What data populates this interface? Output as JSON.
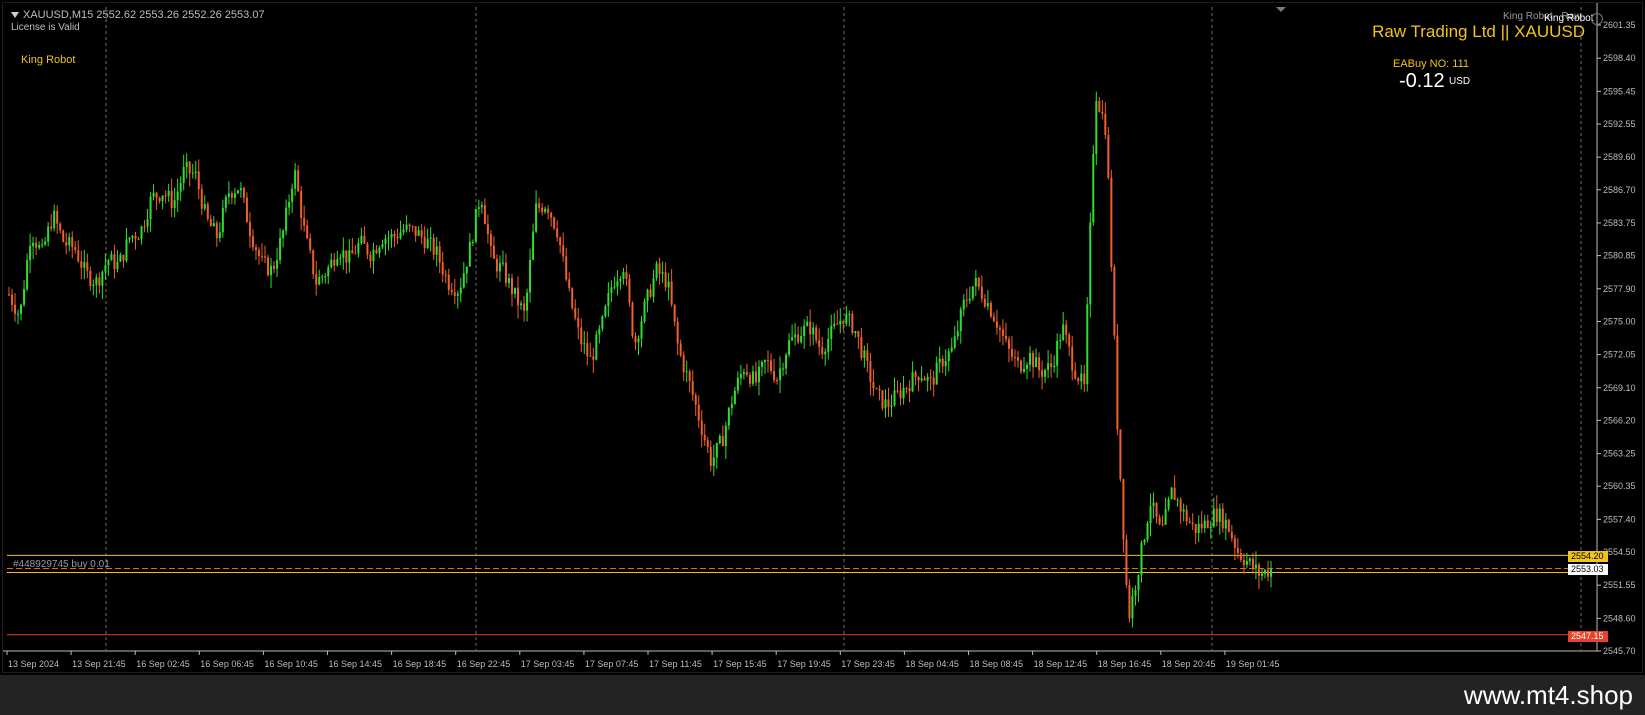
{
  "header": {
    "symbol_info": "XAUUSD,M15  2552.62 2553.26 2552.26 2553.07",
    "license": "License is Valid",
    "ea_name": "King Robot",
    "ea_name_top": "King Robot - Raw",
    "ea_name_top2": "King Robot"
  },
  "panel": {
    "broker_title": "Raw Trading Ltd || XAUUSD",
    "ea_buy": "EABuy NO: 111",
    "pnl": "-0.12",
    "pnl_unit": "USD"
  },
  "order": {
    "label": "#448929745 buy 0.01"
  },
  "price_tags": {
    "yellow": "2554.20",
    "white": "2553.03",
    "red": "2547.15"
  },
  "footer": {
    "watermark": "www.mt4.shop"
  },
  "colors": {
    "bull": "#2ee02e",
    "bear": "#f0602a",
    "gold_line": "#f0c419",
    "red_line": "#e8432a",
    "grid": "#707070"
  },
  "chart_data": {
    "type": "candlestick",
    "symbol": "XAUUSD",
    "timeframe": "M15",
    "y_ticks": [
      "2601.35",
      "2598.40",
      "2595.45",
      "2592.55",
      "2589.60",
      "2586.70",
      "2583.75",
      "2580.85",
      "2577.90",
      "2575.00",
      "2572.05",
      "2569.10",
      "2566.20",
      "2563.25",
      "2560.35",
      "2557.40",
      "2554.50",
      "2551.55",
      "2548.60",
      "2545.70"
    ],
    "ylim": [
      2545.7,
      2601.35
    ],
    "x_ticks": [
      "13 Sep 2024",
      "13 Sep 21:45",
      "16 Sep 02:45",
      "16 Sep 06:45",
      "16 Sep 10:45",
      "16 Sep 14:45",
      "16 Sep 18:45",
      "16 Sep 22:45",
      "17 Sep 03:45",
      "17 Sep 07:45",
      "17 Sep 11:45",
      "17 Sep 15:45",
      "17 Sep 19:45",
      "17 Sep 23:45",
      "18 Sep 04:45",
      "18 Sep 08:45",
      "18 Sep 12:45",
      "18 Sep 16:45",
      "18 Sep 20:45",
      "19 Sep 01:45"
    ],
    "lines": {
      "order_entry": 2554.2,
      "bid": 2553.03,
      "stop_loss": 2547.15
    },
    "path": [
      2577.4,
      2575.5,
      2583.0,
      2581.0,
      2584.5,
      2582.0,
      2581.5,
      2579.2,
      2578.5,
      2580.5,
      2580.0,
      2582.5,
      2583.0,
      2586.0,
      2586.5,
      2585.5,
      2588.5,
      2588.0,
      2584.0,
      2582.5,
      2586.5,
      2587.0,
      2583.0,
      2580.2,
      2579.5,
      2583.0,
      2588.5,
      2582.5,
      2578.5,
      2579.5,
      2581.5,
      2580.5,
      2582.0,
      2581.0,
      2582.5,
      2582.5,
      2583.2,
      2583.0,
      2582.2,
      2581.0,
      2578.5,
      2577.8,
      2581.5,
      2586.5,
      2580.5,
      2579.5,
      2577.5,
      2575.5,
      2585.0,
      2585.5,
      2583.0,
      2577.5,
      2573.5,
      2571.5,
      2574.5,
      2578.5,
      2580.0,
      2573.0,
      2576.5,
      2579.5,
      2578.5,
      2572.5,
      2569.5,
      2566.0,
      2562.5,
      2564.5,
      2568.5,
      2571.0,
      2569.5,
      2571.5,
      2570.0,
      2573.0,
      2574.0,
      2574.5,
      2572.5,
      2574.0,
      2575.5,
      2574.5,
      2571.5,
      2568.5,
      2567.5,
      2568.5,
      2569.5,
      2570.5,
      2569.5,
      2571.5,
      2572.5,
      2576.5,
      2578.5,
      2577.0,
      2575.0,
      2572.5,
      2571.0,
      2572.0,
      2570.5,
      2571.0,
      2574.5,
      2571.0,
      2569.0,
      2595.5,
      2592.0,
      2566.0,
      2548.5,
      2553.5,
      2559.0,
      2556.0,
      2560.0,
      2558.0,
      2556.5,
      2557.0,
      2558.0,
      2557.0,
      2554.5,
      2553.5,
      2552.5,
      2553.0
    ]
  }
}
